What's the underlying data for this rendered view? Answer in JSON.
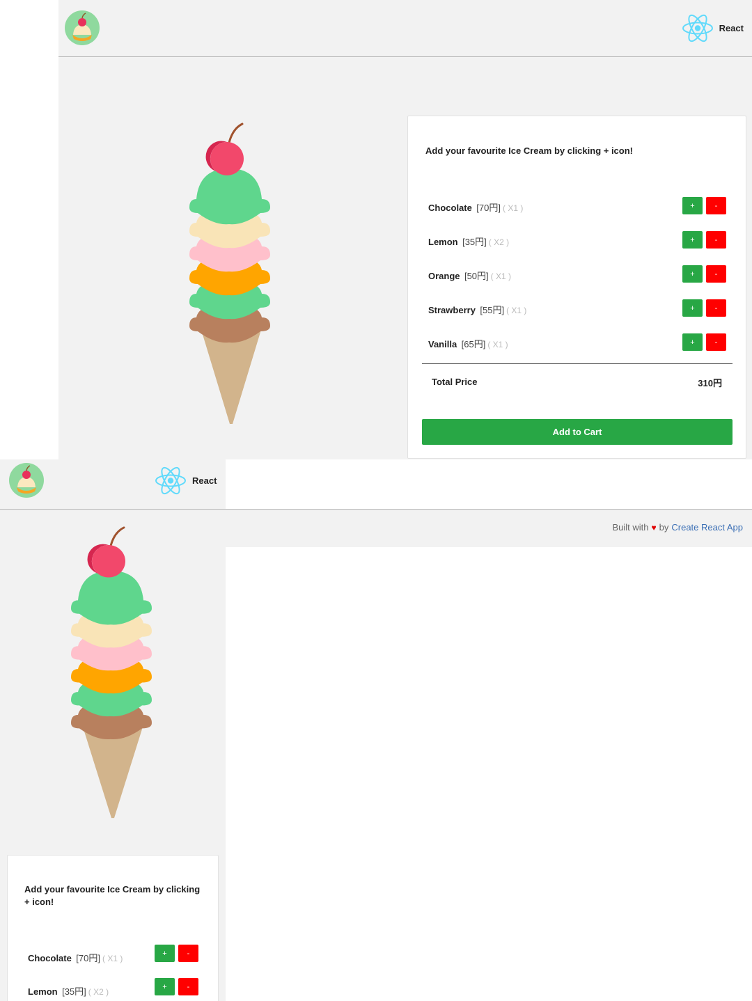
{
  "app": {
    "react_label": "React",
    "instruction": "Add your favourite Ice Cream by clicking + icon!",
    "flavors": [
      {
        "name": "Chocolate",
        "price": "[70円]",
        "qty": "( X1 )"
      },
      {
        "name": "Lemon",
        "price": "[35円]",
        "qty": "( X2 )"
      },
      {
        "name": "Orange",
        "price": "[50円]",
        "qty": "( X1 )"
      },
      {
        "name": "Strawberry",
        "price": "[55円]",
        "qty": "( X1 )"
      },
      {
        "name": "Vanilla",
        "price": "[65円]",
        "qty": "( X1 )"
      }
    ],
    "plus_label": "+",
    "minus_label": "-",
    "total_label": "Total Price",
    "total_value": "310円",
    "cart_button": "Add to Cart"
  },
  "footer": {
    "built_with": "Built with",
    "by": "by",
    "link_text": "Create React App"
  },
  "colors": {
    "background": "#f2f2f2",
    "plus_button": "#28a745",
    "minus_button": "#ff0000",
    "cart_button": "#28a745",
    "react_logo": "#61dafb",
    "link": "#3b6fb5",
    "heart": "#e00000"
  },
  "icons": [
    "ice-cream-cherry-logo-icon",
    "react-logo-icon",
    "heart-icon"
  ],
  "scoop_colors": [
    "#5fd68d",
    "#f9e4b7",
    "#ffc0cb",
    "#ffa500",
    "#5fd68d",
    "#b8805e"
  ]
}
